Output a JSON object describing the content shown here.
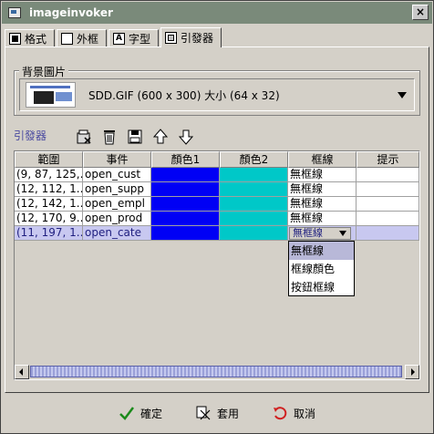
{
  "window": {
    "title": "imageinvoker",
    "close_label": "×"
  },
  "tabs": [
    {
      "label": "格式",
      "icon": "format-icon"
    },
    {
      "label": "外框",
      "icon": "frame-icon"
    },
    {
      "label": "字型",
      "icon": "font-icon"
    },
    {
      "label": "引發器",
      "icon": "trigger-icon",
      "active": true
    }
  ],
  "background": {
    "legend": "背景圖片",
    "selected": "SDD.GIF  (600 x 300)  大小 (64 x 32)"
  },
  "triggers": {
    "label": "引發器",
    "toolbar": [
      "add-icon",
      "delete-icon",
      "save-icon",
      "move-up-icon",
      "move-down-icon"
    ]
  },
  "table": {
    "columns": [
      "範圍",
      "事件",
      "顏色1",
      "顏色2",
      "框線",
      "提示"
    ],
    "rows": [
      {
        "range": "(9, 87, 125,...",
        "event": "open_cust",
        "color1": "#0000f5",
        "color2": "#00c8c8",
        "border": "無框線",
        "tip": ""
      },
      {
        "range": "(12, 112, 1...",
        "event": "open_supp",
        "color1": "#0000f5",
        "color2": "#00c8c8",
        "border": "無框線",
        "tip": ""
      },
      {
        "range": "(12, 142, 1...",
        "event": "open_empl",
        "color1": "#0000f5",
        "color2": "#00c8c8",
        "border": "無框線",
        "tip": ""
      },
      {
        "range": "(12, 170, 9...",
        "event": "open_prod",
        "color1": "#0000f5",
        "color2": "#00c8c8",
        "border": "無框線",
        "tip": ""
      },
      {
        "range": "(11, 197, 1...",
        "event": "open_cate",
        "color1": "#0000f5",
        "color2": "#00c8c8",
        "border": "無框線",
        "tip": "",
        "selected": true
      }
    ],
    "border_options": [
      "無框線",
      "框線顏色",
      "按鈕框線"
    ],
    "highlighted_option": "無框線"
  },
  "footer": {
    "ok_label": "確定",
    "apply_label": "套用",
    "cancel_label": "取消"
  },
  "colors": {
    "accent_blue": "#0000f5",
    "accent_cyan": "#00c8c8",
    "selected_row": "#c8c8f0",
    "titlebar": "#7a8a7a"
  }
}
